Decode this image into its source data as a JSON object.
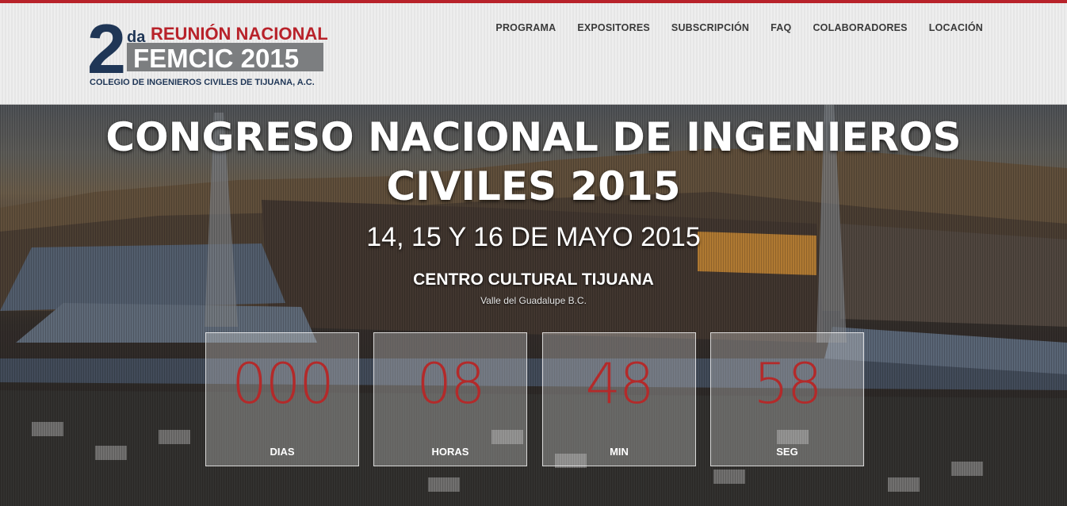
{
  "brand": {
    "logo_number": "2",
    "logo_suffix": "da",
    "logo_line1": "REUNIÓN NACIONAL",
    "logo_line2": "FEMCIC 2015",
    "logo_line3": "COLEGIO DE INGENIEROS CIVILES DE TIJUANA, A.C.",
    "colors": {
      "navy": "#1f3656",
      "red": "#b8222a",
      "gray": "#7c7e80"
    }
  },
  "nav": {
    "items": [
      {
        "label": "PROGRAMA"
      },
      {
        "label": "EXPOSITORES"
      },
      {
        "label": "SUBSCRIPCIÓN"
      },
      {
        "label": "FAQ"
      },
      {
        "label": "COLABORADORES"
      },
      {
        "label": "LOCACIÓN"
      }
    ]
  },
  "hero": {
    "title_line1": "CONGRESO NACIONAL DE INGENIEROS",
    "title_line2": "CIVILES 2015",
    "dates": "14, 15 Y 16 DE MAYO 2015",
    "venue": "CENTRO CULTURAL TIJUANA",
    "location": "Valle del Guadalupe B.C."
  },
  "countdown": [
    {
      "value": "000",
      "label": "DIAS"
    },
    {
      "value": "08",
      "label": "HORAS"
    },
    {
      "value": "48",
      "label": "MIN"
    },
    {
      "value": "58",
      "label": "SEG"
    }
  ],
  "accent_color": "#b32a2a"
}
